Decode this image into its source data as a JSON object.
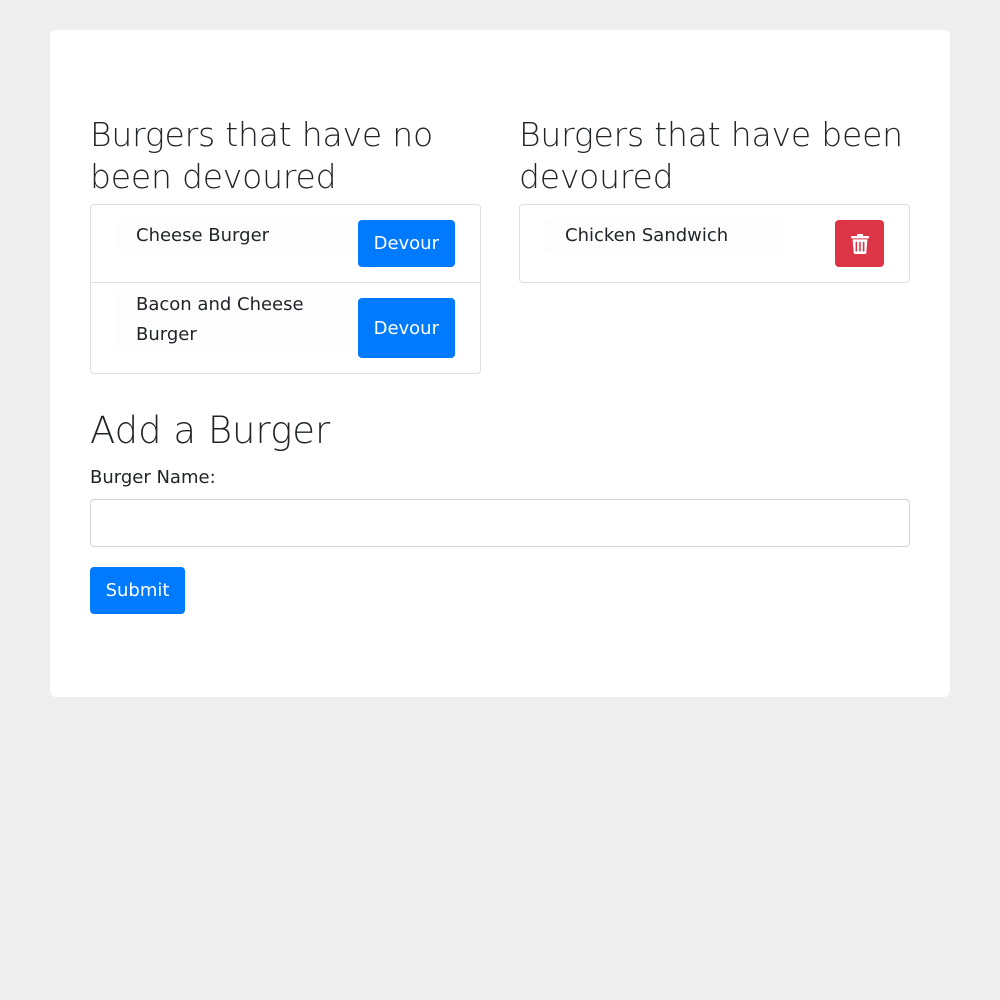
{
  "not_devoured": {
    "heading": "Burgers that have no been devoured",
    "items": [
      {
        "name": "Cheese Burger",
        "button_label": "Devour"
      },
      {
        "name": "Bacon and Cheese Burger",
        "button_label": "Devour"
      }
    ]
  },
  "devoured": {
    "heading": "Burgers that have been devoured",
    "items": [
      {
        "name": "Chicken Sandwich",
        "button_icon": "trash-icon"
      }
    ]
  },
  "add_form": {
    "heading": "Add a Burger",
    "label": "Burger Name:",
    "input_value": "",
    "input_placeholder": "",
    "submit_label": "Submit"
  },
  "colors": {
    "primary": "#007bff",
    "danger": "#dc3545",
    "background": "#eeeeee",
    "card": "#ffffff"
  }
}
